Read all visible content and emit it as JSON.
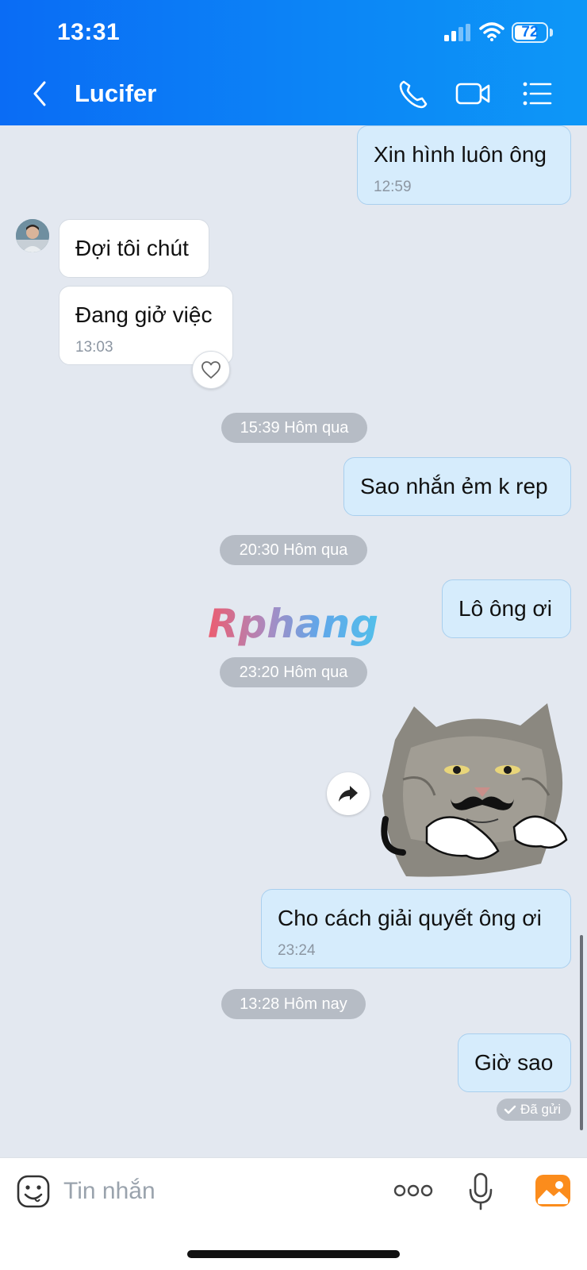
{
  "status_bar": {
    "time": "13:31",
    "battery": "72",
    "battery_level_pct": 72
  },
  "header": {
    "contact_name": "Lucifer",
    "accent": "#0c85f6"
  },
  "messages": [
    {
      "side": "out",
      "text": "Xin hình luôn ông",
      "time": "12:59"
    },
    {
      "side": "in",
      "text": "Đợi tôi chút",
      "time": ""
    },
    {
      "side": "in",
      "text": "Đang giở việc",
      "time": "13:03"
    },
    {
      "side": "out",
      "text": "Sao nhắn ẻm k rep",
      "time": ""
    },
    {
      "side": "out",
      "text": "Lô ông ơi",
      "time": ""
    },
    {
      "side": "out",
      "text": "Cho cách giải quyết ông ơi",
      "time": "23:24"
    },
    {
      "side": "out",
      "text": "Giờ sao",
      "time": ""
    }
  ],
  "date_dividers": [
    "15:39 Hôm qua",
    "20:30 Hôm qua",
    "23:20 Hôm qua",
    "13:28 Hôm nay"
  ],
  "watermark": "Rphang",
  "sent_status": "Đã gửi",
  "composer": {
    "placeholder": "Tin nhắn"
  },
  "icons": [
    "back-icon",
    "phone-icon",
    "video-call-icon",
    "menu-list-icon",
    "heart-icon",
    "forward-icon",
    "emoji-icon",
    "more-icon",
    "microphone-icon",
    "image-icon"
  ]
}
